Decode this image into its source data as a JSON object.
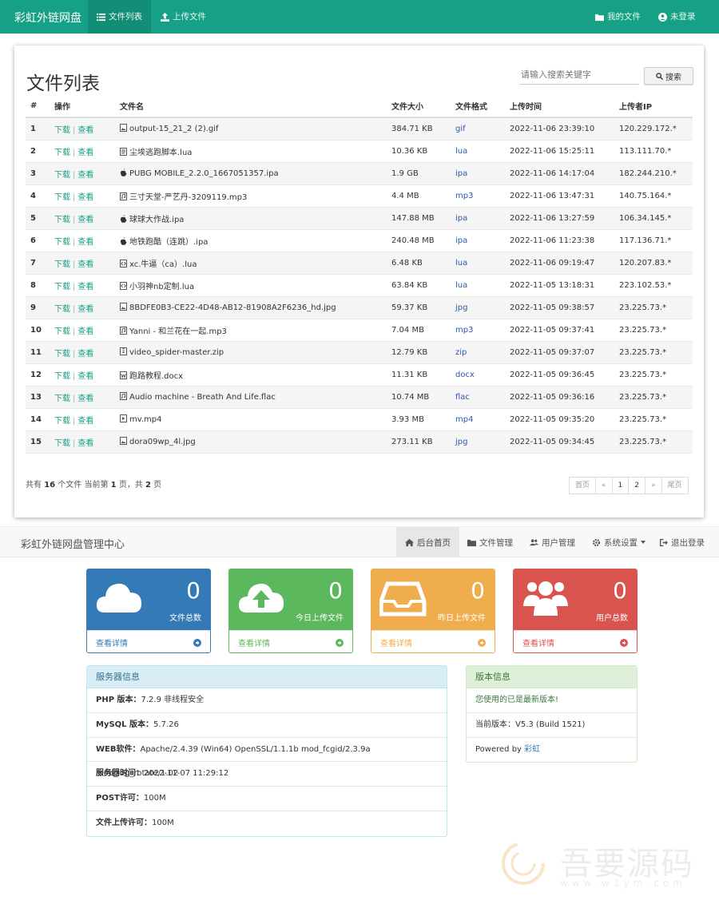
{
  "navbar": {
    "brand": "彩虹外链网盘",
    "items": [
      {
        "label": "文件列表",
        "icon": "list-icon",
        "active": true
      },
      {
        "label": "上传文件",
        "icon": "upload-icon",
        "active": false
      }
    ],
    "right_items": [
      {
        "label": "我的文件",
        "icon": "folder-icon"
      },
      {
        "label": "未登录",
        "icon": "user-circle-icon"
      }
    ]
  },
  "file_panel": {
    "title": "文件列表",
    "search": {
      "placeholder": "请输入搜索关键字",
      "button_label": "搜索"
    },
    "columns": [
      "#",
      "操作",
      "文件名",
      "文件大小",
      "文件格式",
      "上传时间",
      "上传者IP"
    ],
    "action_download": "下载",
    "action_view": "查看",
    "action_sep": "|",
    "rows": [
      {
        "num": "1",
        "name": "output-15_21_2 (2).gif",
        "icon": "image-file-icon",
        "size": "384.71 KB",
        "format": "gif",
        "time": "2022-11-06 23:39:10",
        "ip": "120.229.172.*"
      },
      {
        "num": "2",
        "name": "尘埃逃跑脚本.lua",
        "icon": "text-file-icon",
        "size": "10.36 KB",
        "format": "lua",
        "time": "2022-11-06 15:25:11",
        "ip": "113.111.70.*"
      },
      {
        "num": "3",
        "name": "PUBG MOBILE_2.2.0_1667051357.ipa",
        "icon": "apple-icon",
        "size": "1.9 GB",
        "format": "ipa",
        "time": "2022-11-06 14:17:04",
        "ip": "182.244.210.*"
      },
      {
        "num": "4",
        "name": "三寸天堂-严艺丹-3209119.mp3",
        "icon": "audio-file-icon",
        "size": "4.4 MB",
        "format": "mp3",
        "time": "2022-11-06 13:47:31",
        "ip": "140.75.164.*"
      },
      {
        "num": "5",
        "name": "球球大作战.ipa",
        "icon": "apple-icon",
        "size": "147.88 MB",
        "format": "ipa",
        "time": "2022-11-06 13:27:59",
        "ip": "106.34.145.*"
      },
      {
        "num": "6",
        "name": "地铁跑酷（连跳）.ipa",
        "icon": "apple-icon",
        "size": "240.48 MB",
        "format": "ipa",
        "time": "2022-11-06 11:23:38",
        "ip": "117.136.71.*"
      },
      {
        "num": "7",
        "name": "xc.牛逼（ca）.lua",
        "icon": "code-file-icon",
        "size": "6.48 KB",
        "format": "lua",
        "time": "2022-11-06 09:19:47",
        "ip": "120.207.83.*"
      },
      {
        "num": "8",
        "name": "小羽神nb定制.lua",
        "icon": "code-file-icon",
        "size": "63.84 KB",
        "format": "lua",
        "time": "2022-11-05 13:18:31",
        "ip": "223.102.53.*"
      },
      {
        "num": "9",
        "name": "8BDFE0B3-CE22-4D48-AB12-81908A2F6236_hd.jpg",
        "icon": "image-file-icon",
        "size": "59.37 KB",
        "format": "jpg",
        "time": "2022-11-05 09:38:57",
        "ip": "23.225.73.*"
      },
      {
        "num": "10",
        "name": "Yanni - 和兰花在一起.mp3",
        "icon": "audio-file-icon",
        "size": "7.04 MB",
        "format": "mp3",
        "time": "2022-11-05 09:37:41",
        "ip": "23.225.73.*"
      },
      {
        "num": "11",
        "name": "video_spider-master.zip",
        "icon": "archive-file-icon",
        "size": "12.79 KB",
        "format": "zip",
        "time": "2022-11-05 09:37:07",
        "ip": "23.225.73.*"
      },
      {
        "num": "12",
        "name": "跑路教程.docx",
        "icon": "word-file-icon",
        "size": "11.31 KB",
        "format": "docx",
        "time": "2022-11-05 09:36:45",
        "ip": "23.225.73.*"
      },
      {
        "num": "13",
        "name": "Audio machine - Breath And Life.flac",
        "icon": "audio-file-icon",
        "size": "10.74 MB",
        "format": "flac",
        "time": "2022-11-05 09:36:16",
        "ip": "23.225.73.*"
      },
      {
        "num": "14",
        "name": "mv.mp4",
        "icon": "video-file-icon",
        "size": "3.93 MB",
        "format": "mp4",
        "time": "2022-11-05 09:35:20",
        "ip": "23.225.73.*"
      },
      {
        "num": "15",
        "name": "dora09wp_4l.jpg",
        "icon": "image-file-icon",
        "size": "273.11 KB",
        "format": "jpg",
        "time": "2022-11-05 09:34:45",
        "ip": "23.225.73.*"
      }
    ],
    "summary": {
      "pre": "共有",
      "total": "16",
      "mid1": "个文件 当前第",
      "page": "1",
      "mid2": "页，共",
      "pages": "2",
      "post": "页"
    },
    "pager": [
      "首页",
      "«",
      "1",
      "2",
      "»",
      "尾页"
    ]
  },
  "admin_bar": {
    "brand": "彩虹外链网盘管理中心",
    "items": [
      {
        "label": "后台首页",
        "icon": "home-icon",
        "active": true
      },
      {
        "label": "文件管理",
        "icon": "folder-icon",
        "active": false
      },
      {
        "label": "用户管理",
        "icon": "users-icon",
        "active": false
      },
      {
        "label": "系统设置",
        "icon": "gear-icon",
        "active": false
      },
      {
        "label": "退出登录",
        "icon": "logout-icon",
        "active": false
      }
    ]
  },
  "stats": [
    {
      "count": "0",
      "label": "文件总数",
      "detail": "查看详情",
      "icon": "cloud-icon"
    },
    {
      "count": "0",
      "label": "今日上传文件",
      "detail": "查看详情",
      "icon": "cloud-upload-icon"
    },
    {
      "count": "0",
      "label": "昨日上传文件",
      "detail": "查看详情",
      "icon": "inbox-icon"
    },
    {
      "count": "0",
      "label": "用户总数",
      "detail": "查看详情",
      "icon": "users-icon"
    }
  ],
  "server_info": {
    "title": "服务器信息",
    "rows": [
      {
        "label": "PHP 版本：",
        "value": "7.2.9 非线程安全"
      },
      {
        "label": "MySQL 版本：",
        "value": "5.7.26"
      },
      {
        "label": "WEB软件：",
        "value": "Apache/2.4.39 (Win64) OpenSSL/1.1.1b mod_fcgid/2.3.9a mod_log_rotate/1.02"
      },
      {
        "label": "服务器时间：",
        "value": "2022-11-07 11:29:12"
      },
      {
        "label": "POST许可：",
        "value": "100M"
      },
      {
        "label": "文件上传许可：",
        "value": "100M"
      }
    ]
  },
  "version_info": {
    "title": "版本信息",
    "status": "您使用的已是最新版本!",
    "current_label": "当前版本：",
    "current_value": "V5.3 (Build 1521)",
    "powered_pre": "Powered by",
    "powered_link": "彩虹"
  },
  "watermark": {
    "text": "吾要源码",
    "url": "www.w1ym.com"
  },
  "colors": {
    "navbar": "#16a085",
    "link": "#16a085",
    "format_link": "#2e57a8",
    "blue": "#337ab7",
    "green": "#5cb85c",
    "orange": "#f0ad4e",
    "red": "#d9534f"
  }
}
